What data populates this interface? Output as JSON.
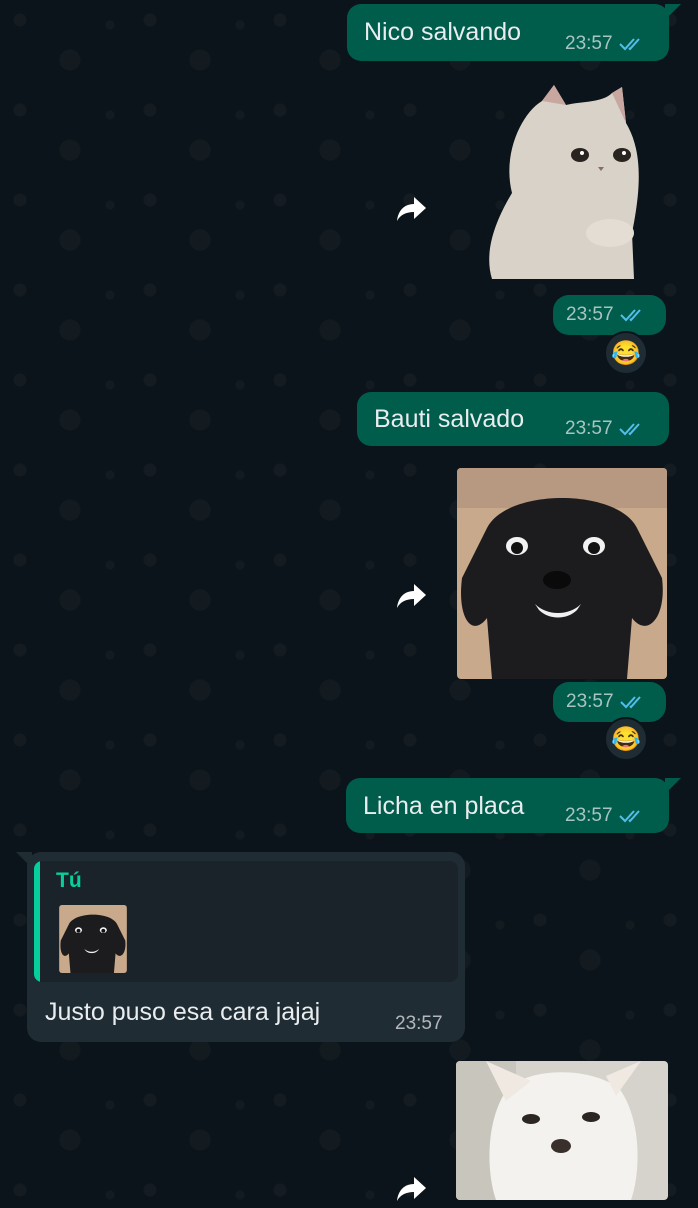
{
  "chat": {
    "messages": [
      {
        "text": "Nico salvando",
        "time": "23:57"
      },
      {
        "sticker": "crying-cat-sticker",
        "time": "23:57",
        "reaction": "😂"
      },
      {
        "text": "Bauti salvado",
        "time": "23:57"
      },
      {
        "sticker": "smiling-black-dog-sticker",
        "time": "23:57",
        "reaction": "😂"
      },
      {
        "text": "Licha en placa",
        "time": "23:57"
      },
      {
        "reply_author": "Tú",
        "text": "Justo puso esa cara jajaj",
        "time": "23:57"
      },
      {
        "sticker": "white-chihuahua-sticker"
      }
    ]
  },
  "colors": {
    "background": "#0b141a",
    "outgoing_bubble": "#005c4b",
    "incoming_bubble": "#202c33",
    "read_tick": "#53bdeb",
    "reply_accent": "#06cf9c"
  }
}
